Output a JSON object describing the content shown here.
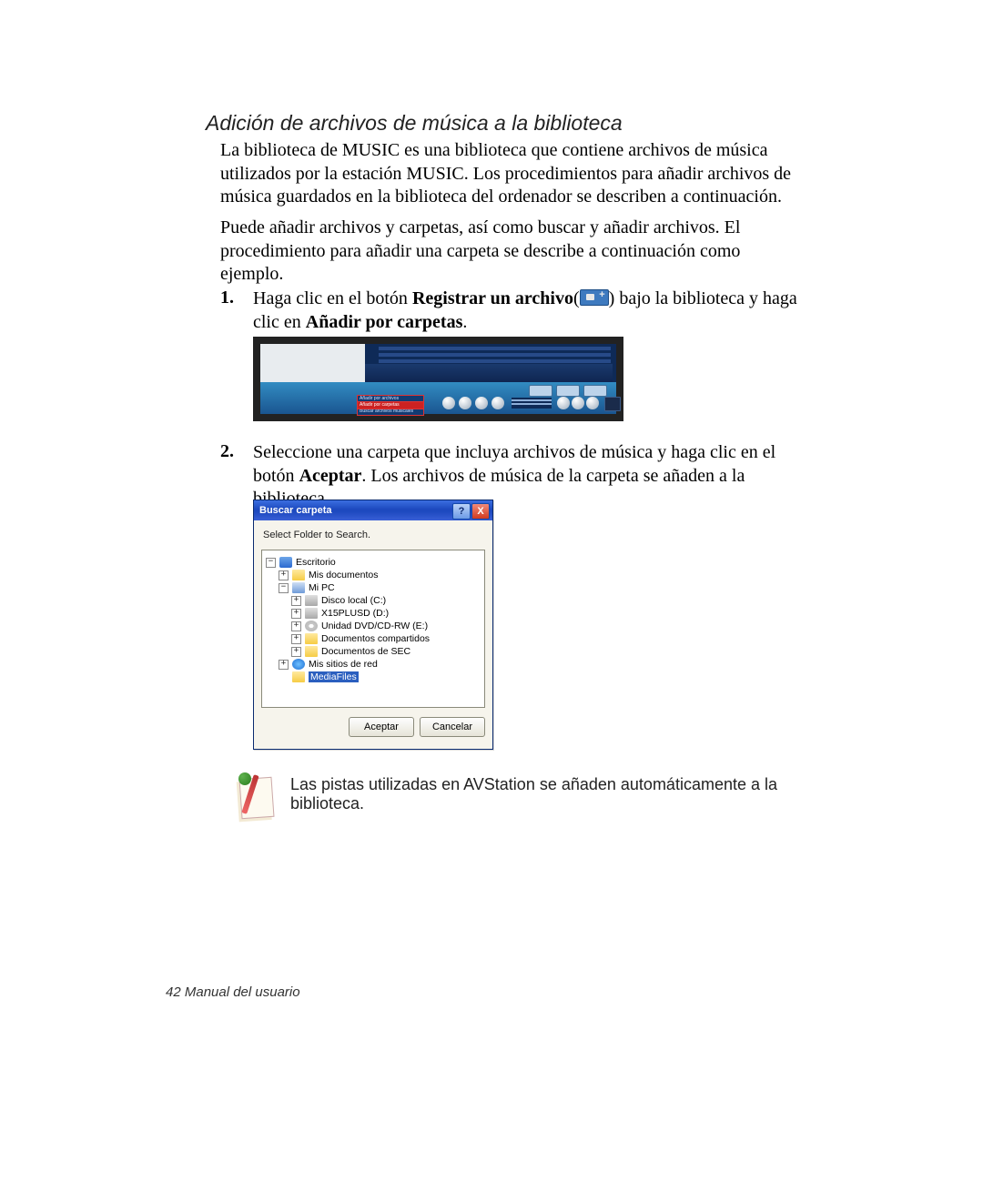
{
  "heading": "Adición de archivos de música a la biblioteca",
  "para1": "La biblioteca de MUSIC es una biblioteca que contiene archivos de música utilizados por la estación MUSIC. Los procedimientos para añadir archivos de música guardados en la biblioteca del ordenador se describen a continuación.",
  "para2": "Puede añadir archivos y carpetas, así como buscar y añadir archivos. El procedimiento para añadir una carpeta se describe a continuación como ejemplo.",
  "step1": {
    "number": "1.",
    "prefix": "Haga clic en el botón ",
    "bold1": "Registrar un archivo",
    "paren_open": "(",
    "paren_close": ") ",
    "mid": "bajo la biblioteca y haga clic en ",
    "bold2": "Añadir por carpetas",
    "suffix": "."
  },
  "player_menu": {
    "item1": "Añadir por archivos",
    "item2_selected": "Añadir por carpetas",
    "item3": "Buscar archivos musicales"
  },
  "step2": {
    "number": "2.",
    "prefix": "Seleccione una carpeta que incluya archivos de música y haga clic en el botón ",
    "bold": "Aceptar",
    "suffix": ". Los archivos de música de la carpeta se añaden a la biblioteca."
  },
  "dialog": {
    "title": "Buscar carpeta",
    "message": "Select Folder to Search.",
    "tree": {
      "desktop": "Escritorio",
      "my_documents": "Mis documentos",
      "my_pc": "Mi PC",
      "drive_c": "Disco local (C:)",
      "drive_d": "X15PLUSD (D:)",
      "dvd": "Unidad DVD/CD-RW (E:)",
      "shared_docs": "Documentos compartidos",
      "sec_docs": "Documentos de SEC",
      "network": "Mis sitios de red",
      "selected": "MediaFiles"
    },
    "ok": "Aceptar",
    "cancel": "Cancelar"
  },
  "note": "Las pistas utilizadas en AVStation se añaden automáticamente a la biblioteca.",
  "footer": {
    "page": "42",
    "label": "  Manual del usuario"
  }
}
